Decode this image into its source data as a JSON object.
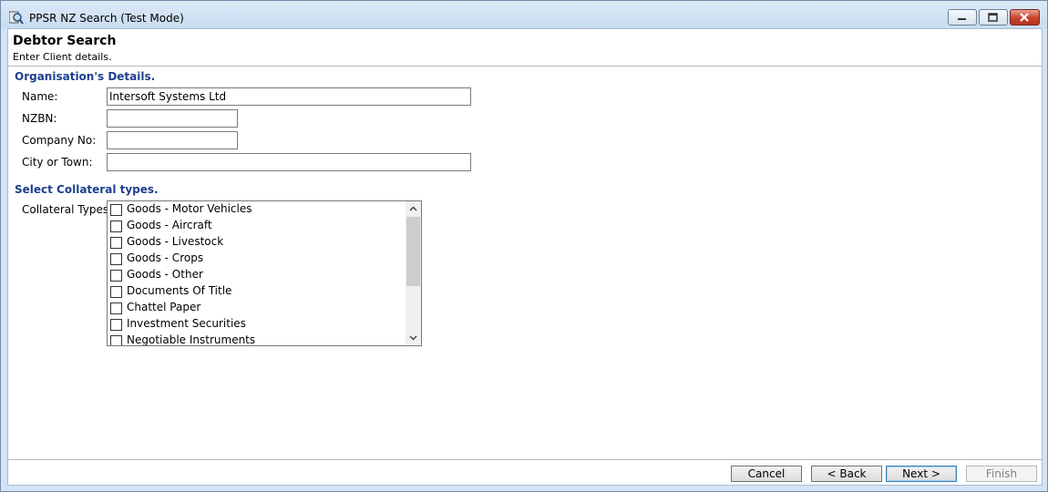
{
  "window": {
    "title": "PPSR NZ Search (Test Mode)"
  },
  "header": {
    "title": "Debtor Search",
    "subtitle": "Enter Client details."
  },
  "org_section": {
    "title": "Organisation's Details.",
    "fields": {
      "name": {
        "label": "Name:",
        "value": "Intersoft Systems Ltd"
      },
      "nzbn": {
        "label": "NZBN:",
        "value": ""
      },
      "company_no": {
        "label": "Company No:",
        "value": ""
      },
      "city": {
        "label": "City or Town:",
        "value": ""
      }
    }
  },
  "collateral_section": {
    "title": "Select Collateral types.",
    "label": "Collateral Types:",
    "items": [
      {
        "label": "Goods - Motor Vehicles",
        "checked": false
      },
      {
        "label": "Goods - Aircraft",
        "checked": false
      },
      {
        "label": "Goods - Livestock",
        "checked": false
      },
      {
        "label": "Goods - Crops",
        "checked": false
      },
      {
        "label": "Goods - Other",
        "checked": false
      },
      {
        "label": "Documents Of Title",
        "checked": false
      },
      {
        "label": "Chattel Paper",
        "checked": false
      },
      {
        "label": "Investment Securities",
        "checked": false
      },
      {
        "label": "Negotiable Instruments",
        "checked": false
      }
    ]
  },
  "buttons": {
    "cancel": "Cancel",
    "back": "< Back",
    "next": "Next >",
    "finish": "Finish"
  },
  "icons": {
    "app": "magnifier-search-icon",
    "scroll_up": "chevron-up-icon",
    "scroll_down": "chevron-down-icon"
  },
  "colors": {
    "section_title": "#1e3f8c",
    "window_frame": "#d5e4f5",
    "close_button": "#c7432e"
  }
}
